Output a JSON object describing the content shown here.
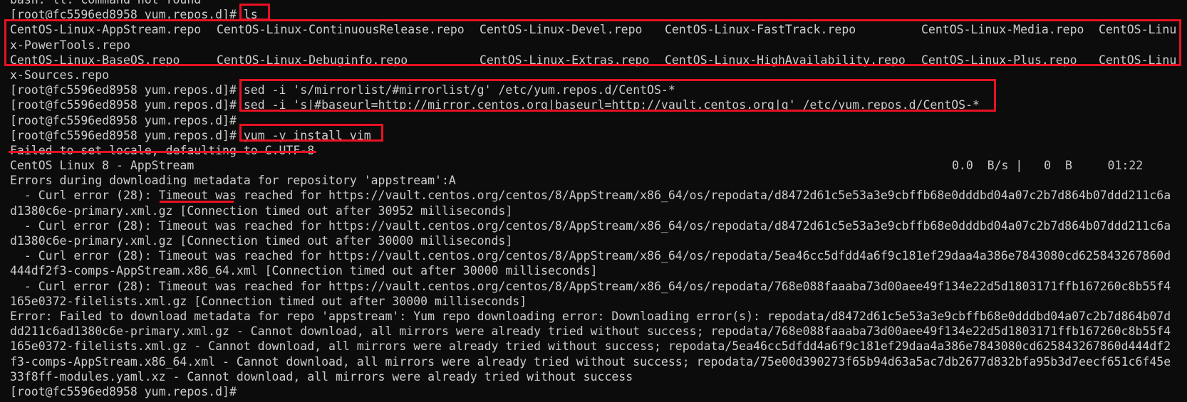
{
  "terminal": {
    "lines": [
      {
        "kind": "text",
        "text": "bash: ll: command not found"
      },
      {
        "kind": "prompt",
        "prompt": "[root@fc5596ed8958 yum.repos.d]# ",
        "cmd": "ls"
      },
      {
        "kind": "row5",
        "cols": [
          "CentOS-Linux-AppStream.repo",
          "CentOS-Linux-ContinuousRelease.repo",
          "CentOS-Linux-Devel.repo",
          "CentOS-Linux-FastTrack.repo",
          "CentOS-Linux-Media.repo",
          "CentOS-Linu"
        ]
      },
      {
        "kind": "text",
        "text": "x-PowerTools.repo"
      },
      {
        "kind": "row5",
        "cols": [
          "CentOS-Linux-BaseOS.repo",
          "CentOS-Linux-Debuginfo.repo",
          "CentOS-Linux-Extras.repo",
          "CentOS-Linux-HighAvailability.repo",
          "CentOS-Linux-Plus.repo",
          "CentOS-Linu"
        ]
      },
      {
        "kind": "text",
        "text": "x-Sources.repo"
      },
      {
        "kind": "prompt",
        "prompt": "[root@fc5596ed8958 yum.repos.d]# ",
        "cmd": "sed -i 's/mirrorlist/#mirrorlist/g' /etc/yum.repos.d/CentOS-*"
      },
      {
        "kind": "prompt",
        "prompt": "[root@fc5596ed8958 yum.repos.d]# ",
        "cmd": "sed -i 's|#baseurl=http://mirror.centos.org|baseurl=http://vault.centos.org|g' /etc/yum.repos.d/CentOS-*"
      },
      {
        "kind": "prompt",
        "prompt": "[root@fc5596ed8958 yum.repos.d]#",
        "cmd": ""
      },
      {
        "kind": "prompt",
        "prompt": "[root@fc5596ed8958 yum.repos.d]# ",
        "cmd": "yum -y install vim"
      },
      {
        "kind": "text",
        "text": "Failed to set locale, defaulting to C.UTF-8"
      },
      {
        "kind": "progress",
        "left": "CentOS Linux 8 - AppStream",
        "right": "0.0  B/s |   0  B     01:22"
      },
      {
        "kind": "text",
        "text": "Errors during downloading metadata for repository 'appstream':A"
      },
      {
        "kind": "text",
        "text": "  - Curl error (28): Timeout was reached for https://vault.centos.org/centos/8/AppStream/x86_64/os/repodata/d8472d61c5e53a3e9cbffb68e0dddbd04a07c2b7d864b07ddd211c6a"
      },
      {
        "kind": "text",
        "text": "d1380c6e-primary.xml.gz [Connection timed out after 30952 milliseconds]"
      },
      {
        "kind": "text",
        "text": "  - Curl error (28): Timeout was reached for https://vault.centos.org/centos/8/AppStream/x86_64/os/repodata/d8472d61c5e53a3e9cbffb68e0dddbd04a07c2b7d864b07ddd211c6a"
      },
      {
        "kind": "text",
        "text": "d1380c6e-primary.xml.gz [Connection timed out after 30000 milliseconds]"
      },
      {
        "kind": "text",
        "text": "  - Curl error (28): Timeout was reached for https://vault.centos.org/centos/8/AppStream/x86_64/os/repodata/5ea46cc5dfdd4a6f9c181ef29daa4a386e7843080cd625843267860d"
      },
      {
        "kind": "text",
        "text": "444df2f3-comps-AppStream.x86_64.xml [Connection timed out after 30000 milliseconds]"
      },
      {
        "kind": "text",
        "text": "  - Curl error (28): Timeout was reached for https://vault.centos.org/centos/8/AppStream/x86_64/os/repodata/768e088faaaba73d00aee49f134e22d5d1803171ffb167260c8b55f4"
      },
      {
        "kind": "text",
        "text": "165e0372-filelists.xml.gz [Connection timed out after 30000 milliseconds]"
      },
      {
        "kind": "text",
        "text": "Error: Failed to download metadata for repo 'appstream': Yum repo downloading error: Downloading error(s): repodata/d8472d61c5e53a3e9cbffb68e0dddbd04a07c2b7d864b07d"
      },
      {
        "kind": "text",
        "text": "dd211c6ad1380c6e-primary.xml.gz - Cannot download, all mirrors were already tried without success; repodata/768e088faaaba73d00aee49f134e22d5d1803171ffb167260c8b55f4"
      },
      {
        "kind": "text",
        "text": "165e0372-filelists.xml.gz - Cannot download, all mirrors were already tried without success; repodata/5ea46cc5dfdd4a6f9c181ef29daa4a386e7843080cd625843267860d444df2"
      },
      {
        "kind": "text",
        "text": "f3-comps-AppStream.x86_64.xml - Cannot download, all mirrors were already tried without success; repodata/75e00d390273f65b94d63a5ac7db2677d832bfa95b3d7eecf651c6f45e"
      },
      {
        "kind": "text",
        "text": "33f8ff-modules.yaml.xz - Cannot download, all mirrors were already tried without success"
      },
      {
        "kind": "prompt",
        "prompt": "[root@fc5596ed8958 yum.repos.d]#",
        "cmd": ""
      }
    ]
  },
  "annotations": {
    "color": "#e81123"
  }
}
